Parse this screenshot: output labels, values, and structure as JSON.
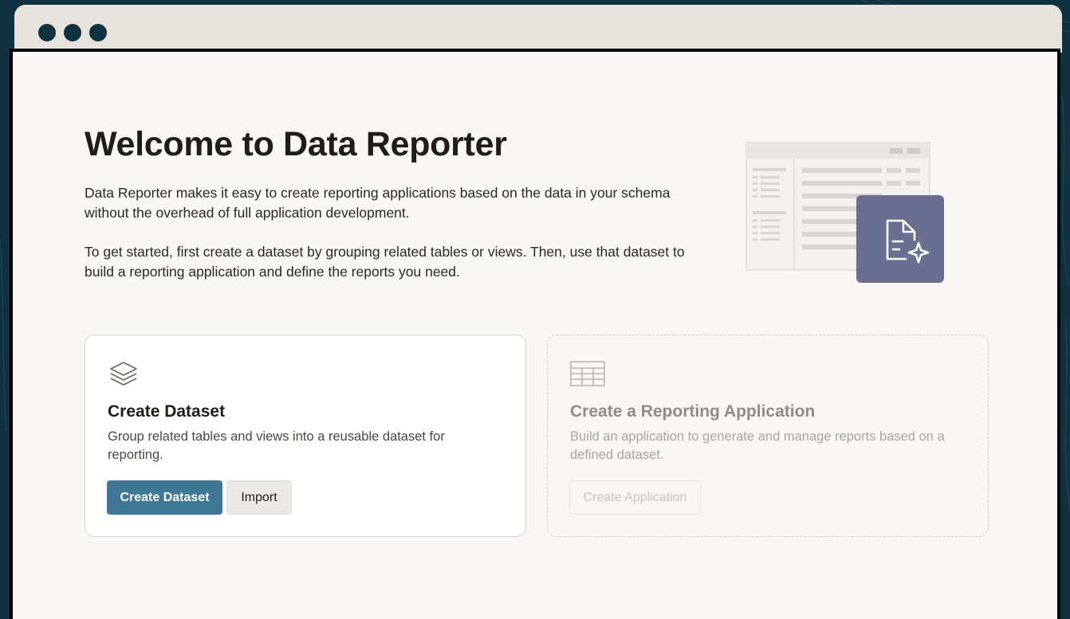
{
  "window": {
    "controls": [
      "window-dot",
      "window-dot",
      "window-dot"
    ]
  },
  "header": {
    "title": "Welcome to Data Reporter",
    "intro_p1": "Data Reporter makes it easy to create reporting applications based on the data in your schema without the overhead of full application development.",
    "intro_p2": "To get started, first create a dataset by grouping related tables or views. Then, use that dataset to build a reporting application and define the reports you need."
  },
  "cards": [
    {
      "icon": "layers-icon",
      "title": "Create Dataset",
      "description": "Group related tables and views into a reusable dataset for reporting.",
      "primary_label": "Create Dataset",
      "secondary_label": "Import"
    },
    {
      "icon": "table-icon",
      "title": "Create a Reporting Application",
      "description": "Build an application to generate and manage reports based on a defined dataset.",
      "button_label": "Create Application",
      "disabled": true
    }
  ],
  "illustration": {
    "icon": "ai-document-icon",
    "accent": "#6a6f91"
  },
  "colors": {
    "background": "#0f3140",
    "window_bar": "#e6e2dc",
    "page": "#f8f7f5",
    "primary_button": "#3f7796"
  }
}
